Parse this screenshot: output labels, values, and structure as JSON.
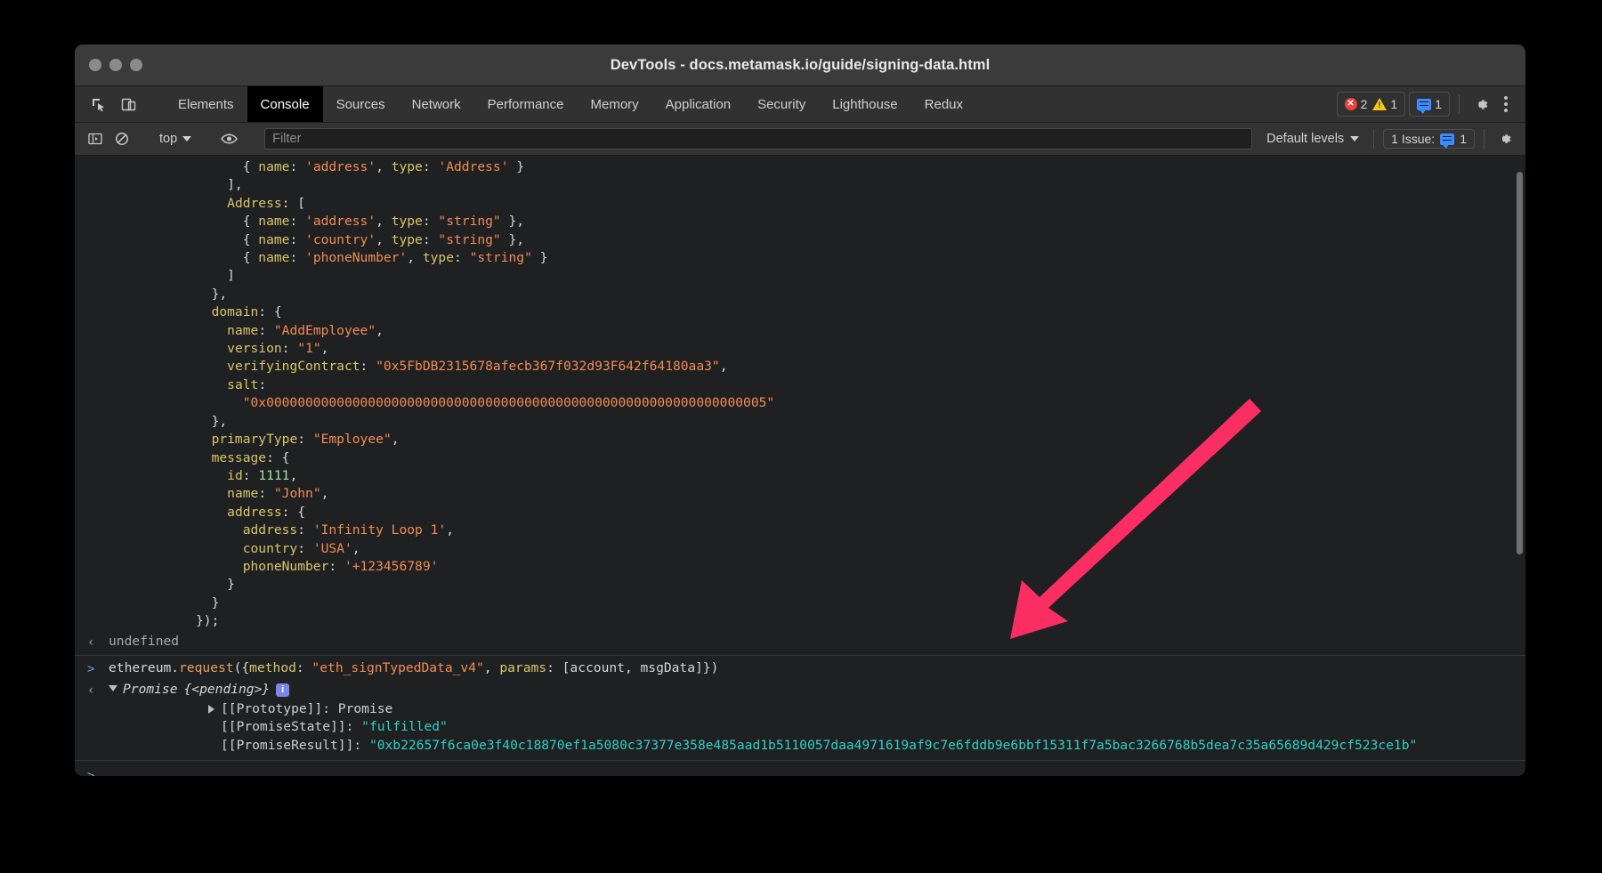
{
  "window": {
    "title": "DevTools - docs.metamask.io/guide/signing-data.html",
    "traffic_lights": [
      "close-button",
      "minimize-button",
      "zoom-button"
    ]
  },
  "tabbar": {
    "inspect_icon": "inspect-element-icon",
    "device_icon": "device-toolbar-icon",
    "tabs": [
      {
        "label": "Elements",
        "active": false
      },
      {
        "label": "Console",
        "active": true
      },
      {
        "label": "Sources",
        "active": false
      },
      {
        "label": "Network",
        "active": false
      },
      {
        "label": "Performance",
        "active": false
      },
      {
        "label": "Memory",
        "active": false
      },
      {
        "label": "Application",
        "active": false
      },
      {
        "label": "Security",
        "active": false
      },
      {
        "label": "Lighthouse",
        "active": false
      },
      {
        "label": "Redux",
        "active": false
      }
    ],
    "error_count": "2",
    "warning_count": "1",
    "message_count": "1",
    "settings_icon": "gear-icon",
    "more_icon": "kebab-menu-icon"
  },
  "console_toolbar": {
    "sidebar_toggle_icon": "console-sidebar-icon",
    "clear_icon": "clear-console-icon",
    "context": "top",
    "eye_icon": "live-expression-icon",
    "filter_placeholder": "Filter",
    "filter_value": "",
    "levels": "Default levels",
    "issues_label": "1 Issue:",
    "issues_count": "1",
    "settings_icon": "console-settings-icon"
  },
  "console": {
    "code_lines": [
      [
        {
          "t": "      { ",
          "c": "p"
        },
        {
          "t": "name",
          "c": "k"
        },
        {
          "t": ": ",
          "c": "p"
        },
        {
          "t": "'address'",
          "c": "s"
        },
        {
          "t": ", ",
          "c": "p"
        },
        {
          "t": "type",
          "c": "k"
        },
        {
          "t": ": ",
          "c": "p"
        },
        {
          "t": "'Address'",
          "c": "s"
        },
        {
          "t": " }",
          "c": "p"
        }
      ],
      [
        {
          "t": "    ],",
          "c": "p"
        }
      ],
      [
        {
          "t": "    ",
          "c": "p"
        },
        {
          "t": "Address",
          "c": "k"
        },
        {
          "t": ": [",
          "c": "p"
        }
      ],
      [
        {
          "t": "      { ",
          "c": "p"
        },
        {
          "t": "name",
          "c": "k"
        },
        {
          "t": ": ",
          "c": "p"
        },
        {
          "t": "'address'",
          "c": "s"
        },
        {
          "t": ", ",
          "c": "p"
        },
        {
          "t": "type",
          "c": "k"
        },
        {
          "t": ": ",
          "c": "p"
        },
        {
          "t": "\"string\"",
          "c": "s"
        },
        {
          "t": " },",
          "c": "p"
        }
      ],
      [
        {
          "t": "      { ",
          "c": "p"
        },
        {
          "t": "name",
          "c": "k"
        },
        {
          "t": ": ",
          "c": "p"
        },
        {
          "t": "'country'",
          "c": "s"
        },
        {
          "t": ", ",
          "c": "p"
        },
        {
          "t": "type",
          "c": "k"
        },
        {
          "t": ": ",
          "c": "p"
        },
        {
          "t": "\"string\"",
          "c": "s"
        },
        {
          "t": " },",
          "c": "p"
        }
      ],
      [
        {
          "t": "      { ",
          "c": "p"
        },
        {
          "t": "name",
          "c": "k"
        },
        {
          "t": ": ",
          "c": "p"
        },
        {
          "t": "'phoneNumber'",
          "c": "s"
        },
        {
          "t": ", ",
          "c": "p"
        },
        {
          "t": "type",
          "c": "k"
        },
        {
          "t": ": ",
          "c": "p"
        },
        {
          "t": "\"string\"",
          "c": "s"
        },
        {
          "t": " }",
          "c": "p"
        }
      ],
      [
        {
          "t": "    ]",
          "c": "p"
        }
      ],
      [
        {
          "t": "  },",
          "c": "p"
        }
      ],
      [
        {
          "t": "  ",
          "c": "p"
        },
        {
          "t": "domain",
          "c": "k"
        },
        {
          "t": ": {",
          "c": "p"
        }
      ],
      [
        {
          "t": "    ",
          "c": "p"
        },
        {
          "t": "name",
          "c": "k"
        },
        {
          "t": ": ",
          "c": "p"
        },
        {
          "t": "\"AddEmployee\"",
          "c": "s"
        },
        {
          "t": ",",
          "c": "p"
        }
      ],
      [
        {
          "t": "    ",
          "c": "p"
        },
        {
          "t": "version",
          "c": "k"
        },
        {
          "t": ": ",
          "c": "p"
        },
        {
          "t": "\"1\"",
          "c": "s"
        },
        {
          "t": ",",
          "c": "p"
        }
      ],
      [
        {
          "t": "    ",
          "c": "p"
        },
        {
          "t": "verifyingContract",
          "c": "k"
        },
        {
          "t": ": ",
          "c": "p"
        },
        {
          "t": "\"0x5FbDB2315678afecb367f032d93F642f64180aa3\"",
          "c": "s"
        },
        {
          "t": ",",
          "c": "p"
        }
      ],
      [
        {
          "t": "    ",
          "c": "p"
        },
        {
          "t": "salt",
          "c": "k"
        },
        {
          "t": ":",
          "c": "p"
        }
      ],
      [
        {
          "t": "      ",
          "c": "p"
        },
        {
          "t": "\"0x0000000000000000000000000000000000000000000000000000000000000005\"",
          "c": "s"
        }
      ],
      [
        {
          "t": "  },",
          "c": "p"
        }
      ],
      [
        {
          "t": "  ",
          "c": "p"
        },
        {
          "t": "primaryType",
          "c": "k"
        },
        {
          "t": ": ",
          "c": "p"
        },
        {
          "t": "\"Employee\"",
          "c": "s"
        },
        {
          "t": ",",
          "c": "p"
        }
      ],
      [
        {
          "t": "  ",
          "c": "p"
        },
        {
          "t": "message",
          "c": "k"
        },
        {
          "t": ": {",
          "c": "p"
        }
      ],
      [
        {
          "t": "    ",
          "c": "p"
        },
        {
          "t": "id",
          "c": "k"
        },
        {
          "t": ": ",
          "c": "p"
        },
        {
          "t": "1111",
          "c": "n"
        },
        {
          "t": ",",
          "c": "p"
        }
      ],
      [
        {
          "t": "    ",
          "c": "p"
        },
        {
          "t": "name",
          "c": "k"
        },
        {
          "t": ": ",
          "c": "p"
        },
        {
          "t": "\"John\"",
          "c": "s"
        },
        {
          "t": ",",
          "c": "p"
        }
      ],
      [
        {
          "t": "    ",
          "c": "p"
        },
        {
          "t": "address",
          "c": "k"
        },
        {
          "t": ": {",
          "c": "p"
        }
      ],
      [
        {
          "t": "      ",
          "c": "p"
        },
        {
          "t": "address",
          "c": "k"
        },
        {
          "t": ": ",
          "c": "p"
        },
        {
          "t": "'Infinity Loop 1'",
          "c": "s"
        },
        {
          "t": ",",
          "c": "p"
        }
      ],
      [
        {
          "t": "      ",
          "c": "p"
        },
        {
          "t": "country",
          "c": "k"
        },
        {
          "t": ": ",
          "c": "p"
        },
        {
          "t": "'USA'",
          "c": "s"
        },
        {
          "t": ",",
          "c": "p"
        }
      ],
      [
        {
          "t": "      ",
          "c": "p"
        },
        {
          "t": "phoneNumber",
          "c": "k"
        },
        {
          "t": ": ",
          "c": "p"
        },
        {
          "t": "'+123456789'",
          "c": "s"
        }
      ],
      [
        {
          "t": "    }",
          "c": "p"
        }
      ],
      [
        {
          "t": "  }",
          "c": "p"
        }
      ],
      [
        {
          "t": "});",
          "c": "p"
        }
      ]
    ],
    "undefined_result": "undefined",
    "command": {
      "gutter": ">",
      "parts": [
        {
          "t": "ethereum.",
          "c": "p"
        },
        {
          "t": "request",
          "c": "fn"
        },
        {
          "t": "({",
          "c": "p"
        },
        {
          "t": "method",
          "c": "k"
        },
        {
          "t": ": ",
          "c": "p"
        },
        {
          "t": "\"eth_signTypedData_v4\"",
          "c": "s"
        },
        {
          "t": ", ",
          "c": "p"
        },
        {
          "t": "params",
          "c": "k"
        },
        {
          "t": ": [account, msgData]})",
          "c": "p"
        }
      ]
    },
    "promise": {
      "gutter": "<",
      "label": "Promise",
      "state_inline": "{<pending>}",
      "info_badge": "i",
      "rows": [
        {
          "name": "[[Prototype]]",
          "value": "Promise",
          "value_class": "prop-name",
          "expandable": true
        },
        {
          "name": "[[PromiseState]]",
          "value": "\"fulfilled\"",
          "value_class": "teal",
          "expandable": false
        },
        {
          "name": "[[PromiseResult]]",
          "value": "\"0xb22657f6ca0e3f40c18870ef1a5080c37377e358e485aad1b5110057daa4971619af9c7e6fddb9e6bbf15311f7a5bac3266768b5dea7c35a65689d429cf523ce1b\"",
          "value_class": "teal",
          "expandable": false
        }
      ]
    },
    "prompt_symbol": ">",
    "prompt_value": ""
  },
  "annotation": {
    "arrow_color": "#FB2E63",
    "arrow_name": "pointer-arrow-to-promise-result"
  },
  "colors": {
    "background": "#000000",
    "window_chrome": "#3b3b3b",
    "tabbar": "#313131",
    "console_bg": "#1f2021",
    "accent_blue": "#3a8bfd",
    "error_red": "#e8443a",
    "warning_yellow": "#f5c518",
    "string_orange": "#f28b54",
    "key_yellow": "#d8c56a",
    "teal": "#2fd1c5"
  }
}
